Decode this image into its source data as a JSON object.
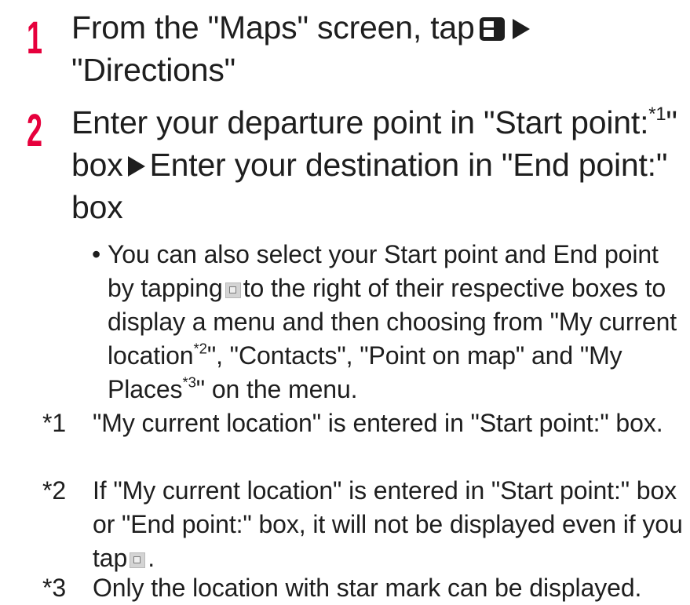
{
  "steps": [
    {
      "number": "1",
      "text_1": "From the \"Maps\" screen, tap",
      "icon": "menu-key-icon",
      "text_2": "\"Directions\""
    },
    {
      "number": "2",
      "text_1": "Enter your departure point in \"Start point:",
      "sup": "*1",
      "text_2": "\" box",
      "text_3": "Enter your destination in \"End point:\" box"
    }
  ],
  "bullet": {
    "symbol": "•",
    "text_1": "You can also select your Start point and End point by tapping",
    "icon": "location-picker-icon",
    "text_2": "to the right of their respective boxes to display a menu and then choosing from \"My current location",
    "sup_1": "*2",
    "text_3": "\", \"Contacts\", \"Point on map\" and \"My Places",
    "sup_2": "*3",
    "text_4": "\" on the menu."
  },
  "footnotes": [
    {
      "mark": "*1",
      "text": "\"My current location\" is entered in \"Start point:\" box."
    },
    {
      "mark": "*2",
      "text_1": "If \"My current location\" is entered in \"Start point:\" box or \"End point:\" box, it will not be displayed even if you tap",
      "icon": "location-picker-icon",
      "text_2": "."
    },
    {
      "mark": "*3",
      "text": "Only the location with star mark can be displayed."
    }
  ],
  "colors": {
    "step_number": "#e6003c",
    "text": "#1e1e1e",
    "picker_icon_bg": "#d4d4d4"
  }
}
